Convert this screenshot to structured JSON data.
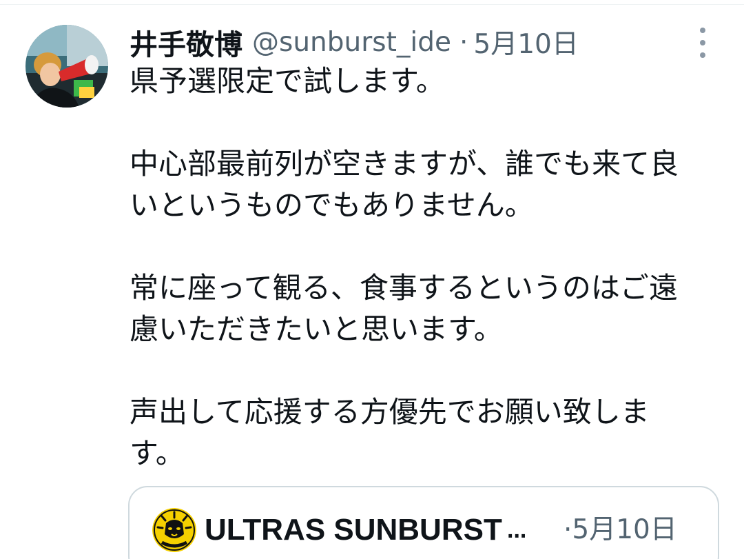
{
  "tweet": {
    "display_name": "井手敬博",
    "handle": "@sunburst_ide",
    "separator": "·",
    "date": "5月10日",
    "more_icon": "more-vertical-icon",
    "paragraphs": [
      "県予選限定で試します。",
      "中心部最前列が空きますが、誰でも来て良\nいというものでもありません。",
      "常に座って観る、食事するというのはご遠\n慮いただきたいと思います。",
      "声出して応援する方優先でお願い致しま\nす。"
    ]
  },
  "quoted_tweet": {
    "display_name": "ULTRAS SUNBURST",
    "ellipsis": "...",
    "separator": "·",
    "date": "5月10日",
    "avatar_text": "SUNBURST",
    "avatar_colors": {
      "background": "#f5d000",
      "lion": "#111111"
    }
  },
  "colors": {
    "text_primary": "#0f1419",
    "text_secondary": "#536471",
    "border": "#cfd9de"
  }
}
